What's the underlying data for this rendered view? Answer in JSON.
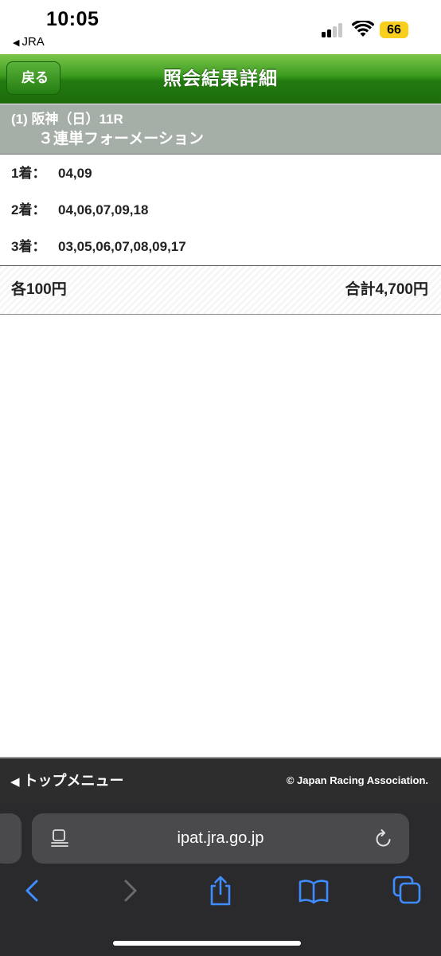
{
  "status_bar": {
    "time": "10:05",
    "back_app": "JRA",
    "battery": "66"
  },
  "header": {
    "back_label": "戻る",
    "title": "照会結果詳細"
  },
  "race": {
    "line1": "(1) 阪神（日）11R",
    "line2": "３連単フォーメーション"
  },
  "rows": [
    {
      "label": "1着：",
      "value": "04,09"
    },
    {
      "label": "2着：",
      "value": "04,06,07,09,18"
    },
    {
      "label": "3着：",
      "value": "03,05,06,07,08,09,17"
    }
  ],
  "summary": {
    "each": "各100円",
    "total": "合計4,700円"
  },
  "footer": {
    "menu_label": "トップメニュー",
    "copyright": "© Japan Racing Association."
  },
  "browser": {
    "url": "ipat.jra.go.jp"
  },
  "colors": {
    "header_green": "#237a10",
    "race_header_gray": "#a6aea8",
    "battery_yellow": "#f7cf1c",
    "browser_icon_blue": "#3f8cff"
  }
}
